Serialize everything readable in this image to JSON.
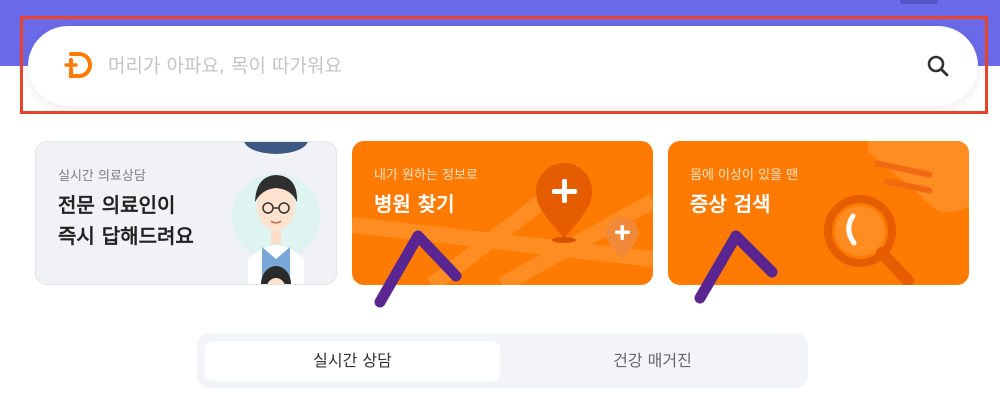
{
  "search": {
    "placeholder": "머리가 아파요, 목이 따가워요"
  },
  "cards": {
    "consult": {
      "subtitle": "실시간 의료상담",
      "title_line1": "전문 의료인이",
      "title_line2": "즉시 답해드려요"
    },
    "hospital": {
      "subtitle": "내가 원하는 정보로",
      "title": "병원 찾기"
    },
    "symptom": {
      "subtitle": "몸에 이상이 있을 땐",
      "title": "증상 검색"
    }
  },
  "tabs": [
    {
      "label": "실시간 상담",
      "active": true
    },
    {
      "label": "건강 매거진",
      "active": false
    }
  ],
  "colors": {
    "header": "#6a6ae8",
    "brand_orange": "#ff7a00",
    "highlight": "#e8442a",
    "annotation_arrow": "#5a2590"
  },
  "icons": [
    "brand-logo-icon",
    "search-icon",
    "map-pin-plus-icon",
    "magnifier-icon",
    "doctor-illustration"
  ]
}
